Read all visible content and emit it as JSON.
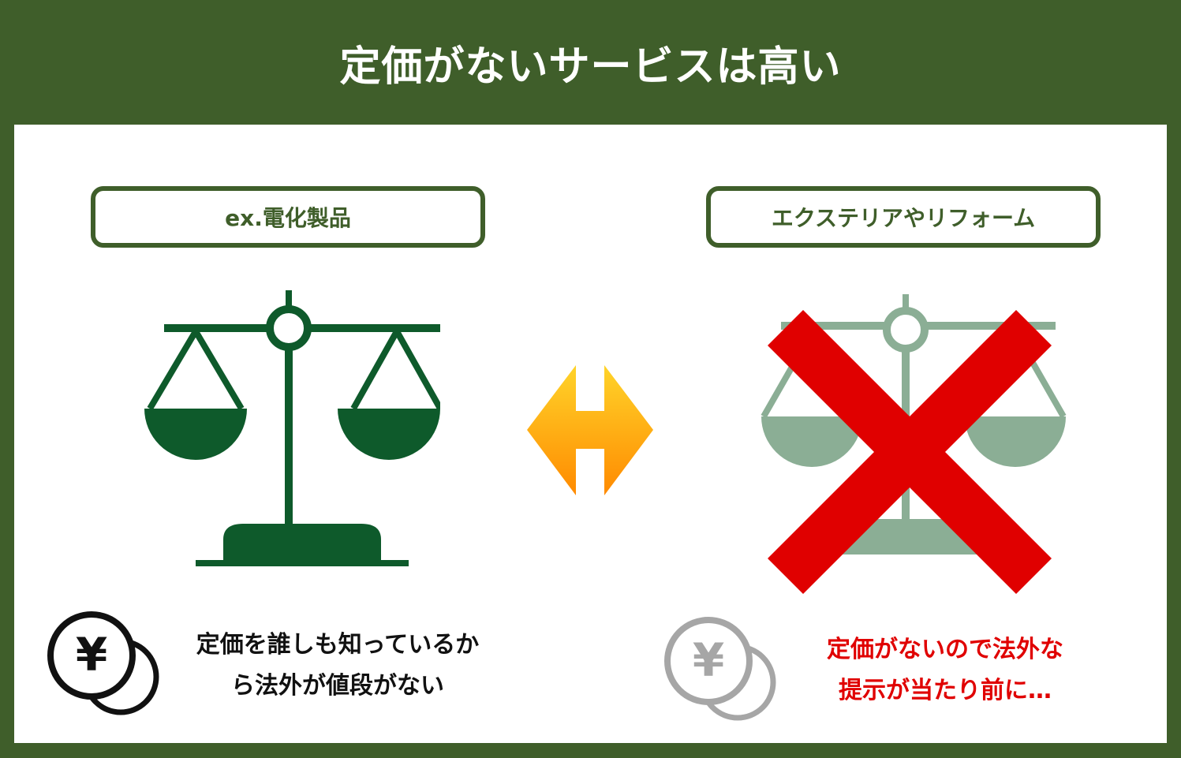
{
  "title": "定価がないサービスは高い",
  "left": {
    "label": "ex.電化製品",
    "caption_line1": "定価を誰しも知っているか",
    "caption_line2": "ら法外が値段がない"
  },
  "right": {
    "label": "エクステリアやリフォーム",
    "caption_line1": "定価がないので法外な",
    "caption_line2": "提示が当たり前に…"
  },
  "icons": {
    "scale": "balance-scale-icon",
    "arrow": "double-arrow-icon",
    "cross": "red-x-icon",
    "coin": "yen-coin-icon",
    "yen_symbol": "¥"
  },
  "colors": {
    "brand_green": "#3f5e2a",
    "scale_green": "#0e5a2b",
    "scale_faded": "#8bae95",
    "cross_red": "#e00000",
    "arrow_orange": "#f5a623"
  }
}
